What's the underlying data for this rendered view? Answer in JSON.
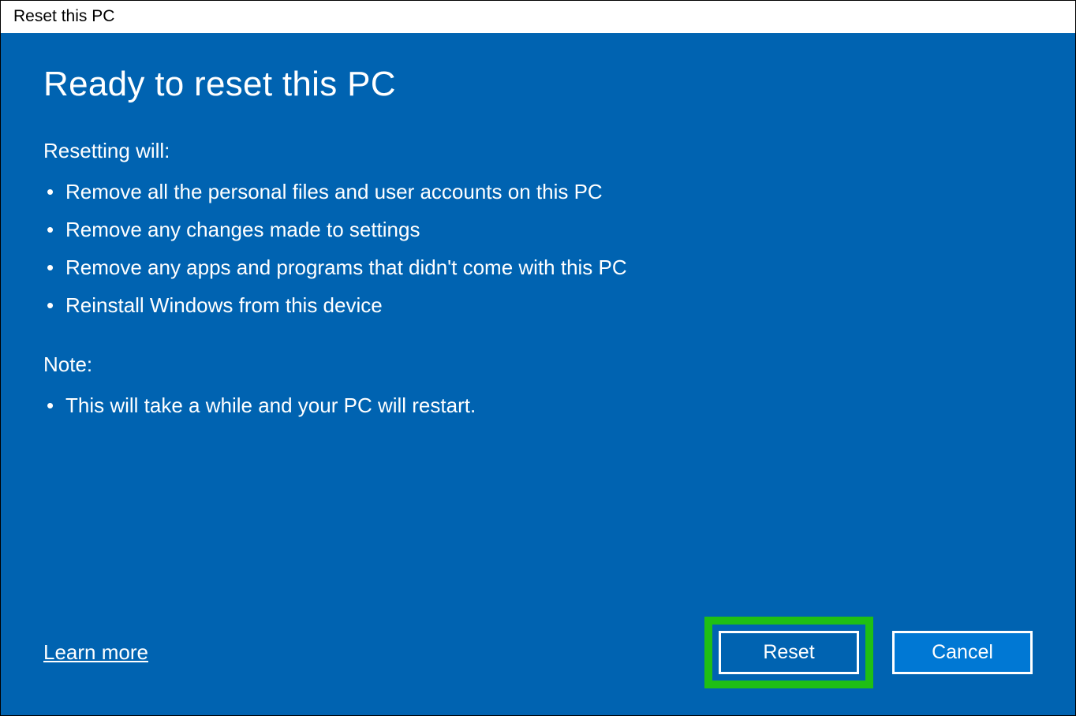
{
  "titlebar": {
    "title": "Reset this PC"
  },
  "main": {
    "heading": "Ready to reset this PC",
    "resetting_label": "Resetting will:",
    "resetting_items": [
      "Remove all the personal files and user accounts on this PC",
      "Remove any changes made to settings",
      "Remove any apps and programs that didn't come with this PC",
      "Reinstall Windows from this device"
    ],
    "note_label": "Note:",
    "note_items": [
      "This will take a while and your PC will restart."
    ]
  },
  "footer": {
    "learn_more": "Learn more",
    "reset_label": "Reset",
    "cancel_label": "Cancel"
  }
}
